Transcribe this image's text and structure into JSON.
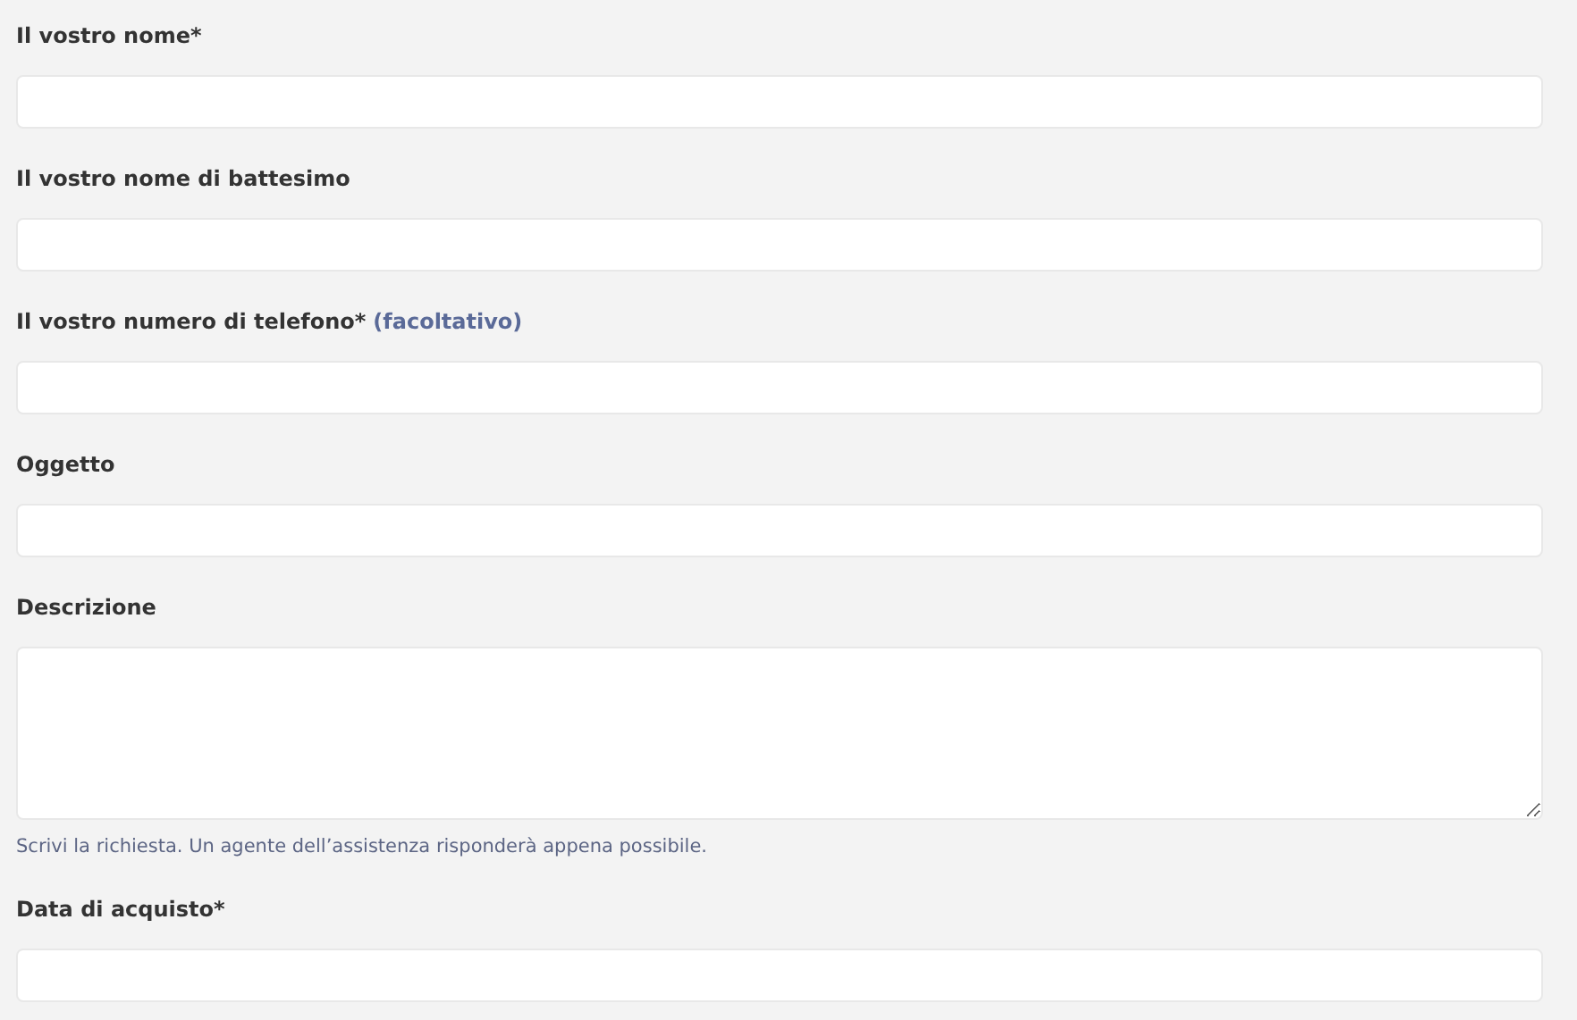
{
  "fields": [
    {
      "label": "Il vostro nome*",
      "kind": "input"
    },
    {
      "label": "Il vostro nome di battesimo",
      "kind": "input"
    },
    {
      "label": "Il vostro numero di telefono*",
      "note": "(facoltativo)",
      "kind": "input"
    },
    {
      "label": "Oggetto",
      "kind": "input"
    },
    {
      "label": "Descrizione",
      "kind": "textarea",
      "hint": "Scrivi la richiesta. Un agente dell’assistenza risponderà appena possibile."
    },
    {
      "label": "Data di acquisto*",
      "kind": "input"
    }
  ]
}
